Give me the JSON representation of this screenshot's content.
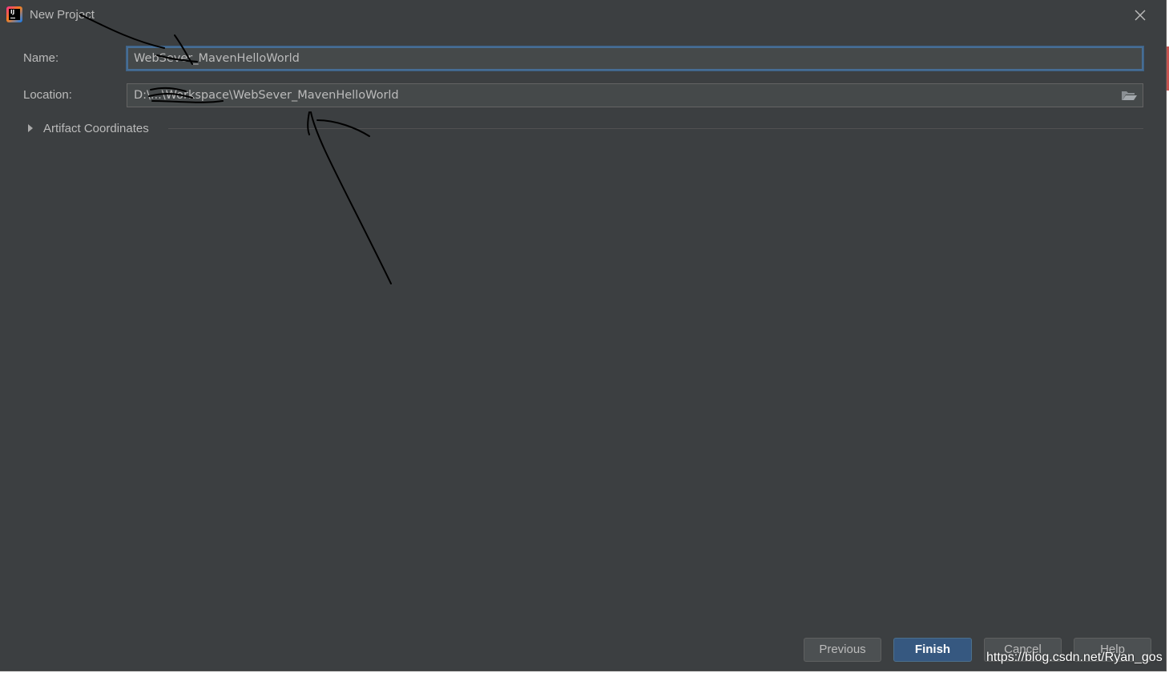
{
  "window": {
    "title": "New Project",
    "icon": "intellij-idea-icon"
  },
  "form": {
    "name_label": "Name:",
    "name_value": "WebSever_MavenHelloWorld",
    "location_label": "Location:",
    "location_value": "D:\\...\\Workspace\\WebSever_MavenHelloWorld",
    "browse_icon": "folder-open-icon"
  },
  "artifact": {
    "label": "Artifact Coordinates",
    "expanded": false
  },
  "buttons": {
    "previous": "Previous",
    "finish": "Finish",
    "cancel": "Cancel",
    "help": "Help"
  },
  "watermark": "https://blog.csdn.net/Ryan_gos",
  "colors": {
    "background": "#3c3f41",
    "input_background": "#45494a",
    "focus_border": "#466d94",
    "primary_button": "#365880",
    "text": "#bbbbbb"
  }
}
